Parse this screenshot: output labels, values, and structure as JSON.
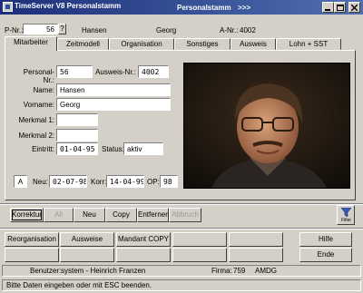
{
  "window": {
    "title": "TimeServer V8 Personalstamm",
    "header_label": "Personalstamm",
    "header_arrows": ">>>"
  },
  "header": {
    "pnr_label": "P-Nr.:",
    "pnr_value": "56",
    "help_mark": "?",
    "last_name": "Hansen",
    "first_name": "Georg",
    "anr_label": "A-Nr.:",
    "anr_value": "4002"
  },
  "tabs": [
    "Mitarbeiter",
    "Zeitmodell",
    "Organisation",
    "Sonstiges",
    "Ausweis",
    "Lohn + SST"
  ],
  "form": {
    "personal_nr_label": "Personal-Nr.:",
    "personal_nr": "56",
    "ausweis_nr_label": "Ausweis-Nr.:",
    "ausweis_nr": "4002",
    "name_label": "Name:",
    "name": "Hansen",
    "vorname_label": "Vorname:",
    "vorname": "Georg",
    "merkmal1_label": "Merkmal 1:",
    "merkmal1": "",
    "merkmal2_label": "Merkmal 2:",
    "merkmal2": "",
    "eintritt_label": "Eintritt:",
    "eintritt": "01-04-95",
    "status_label": "Status:",
    "status": "aktiv",
    "a_value": "A",
    "neu_label": "Neu:",
    "neu": "02-07-98",
    "korr_label": "Korr:",
    "korr": "14-04-99",
    "op_label": "OP:",
    "op": "98"
  },
  "actions": {
    "korrektur": "Korrektur",
    "all": "All",
    "neu": "Neu",
    "copy": "Copy",
    "entfernen": "Entfernen",
    "abbruch": "Abbruch",
    "filter": "Filter"
  },
  "bottom_buttons": {
    "reorganisation": "Reorganisation",
    "ausweise": "Ausweise",
    "mandant_copy": "Mandant COPY",
    "hilfe": "Hilfe",
    "ende": "Ende"
  },
  "footer": {
    "benutzer_label": "Benutzer:",
    "benutzer": "system - Heinrich Franzen",
    "firma_label": "Firma:",
    "firma": "759",
    "firma_name": "AMDG",
    "message": "Bitte Daten eingeben oder mit ESC beenden."
  }
}
